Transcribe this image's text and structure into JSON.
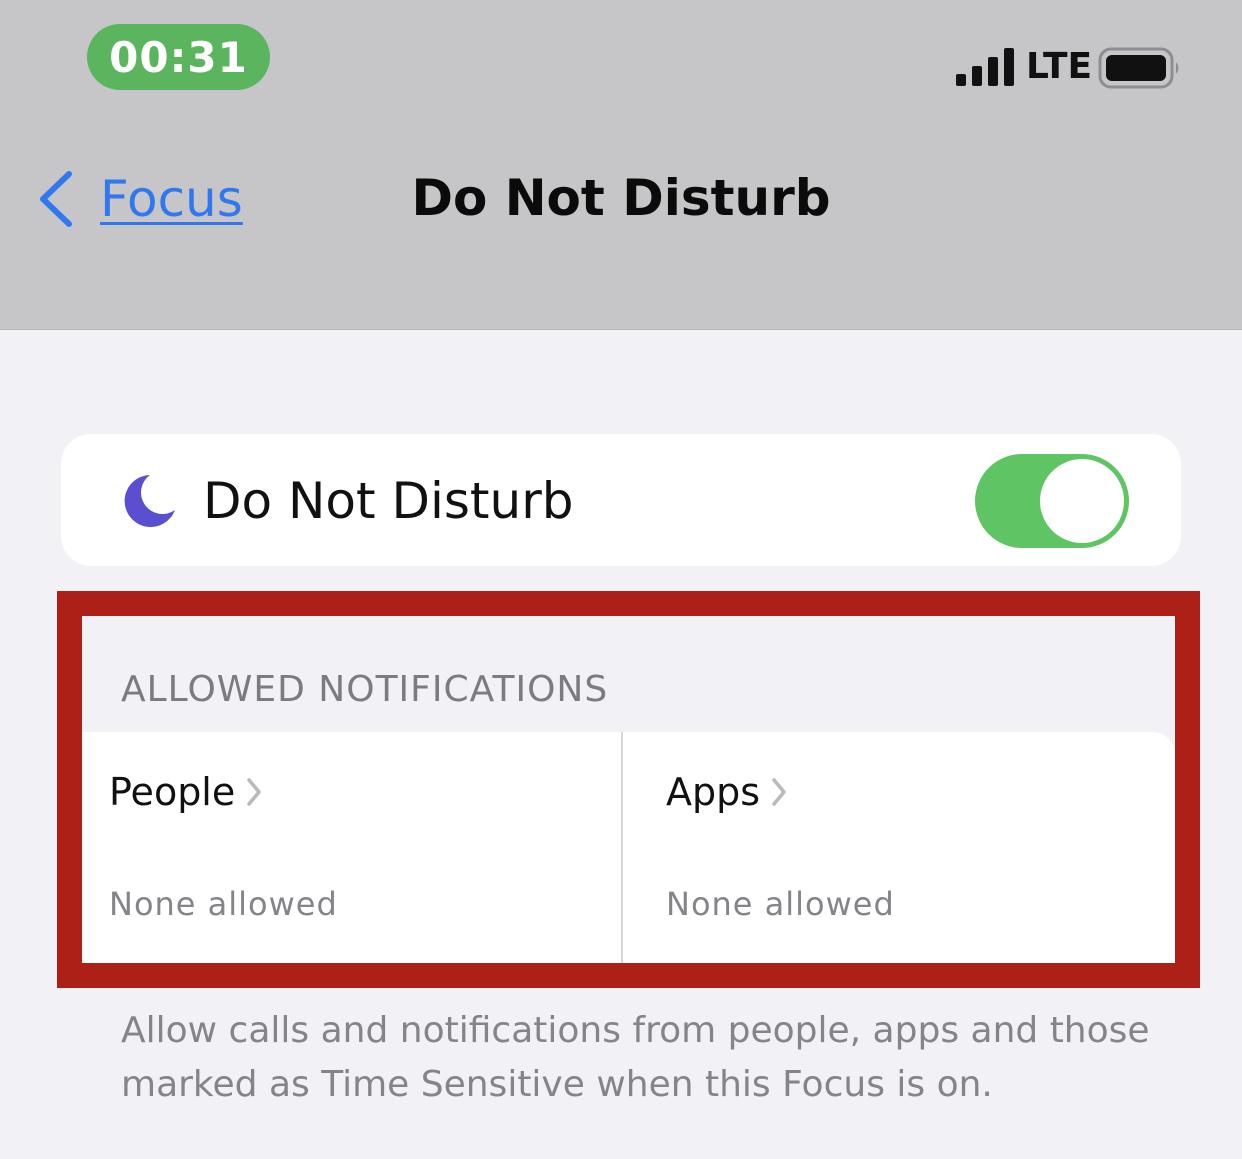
{
  "status_bar": {
    "time": "00:31",
    "carrier": "LTE",
    "icons": {
      "signal": "signal-bars-icon",
      "battery": "battery-icon"
    },
    "colors": {
      "time_pill": "#5ab55e"
    }
  },
  "nav": {
    "back_label": "Focus",
    "back_icon": "chevron-left-icon",
    "title": "Do Not Disturb",
    "accent_color": "#3177ef"
  },
  "focus_toggle": {
    "icon": "moon-icon",
    "label": "Do Not Disturb",
    "enabled": true,
    "colors": {
      "on": "#5fc463",
      "moon": "#5a4fd1"
    }
  },
  "allowed_notifications": {
    "header": "ALLOWED NOTIFICATIONS",
    "items": [
      {
        "title": "People",
        "subtitle": "None allowed",
        "icon": "chevron-right-icon"
      },
      {
        "title": "Apps",
        "subtitle": "None allowed",
        "icon": "chevron-right-icon"
      }
    ],
    "footer": "Allow calls and notifications from people, apps and those marked as Time Sensitive when this Focus is on.",
    "highlight_color": "#ad2017"
  }
}
